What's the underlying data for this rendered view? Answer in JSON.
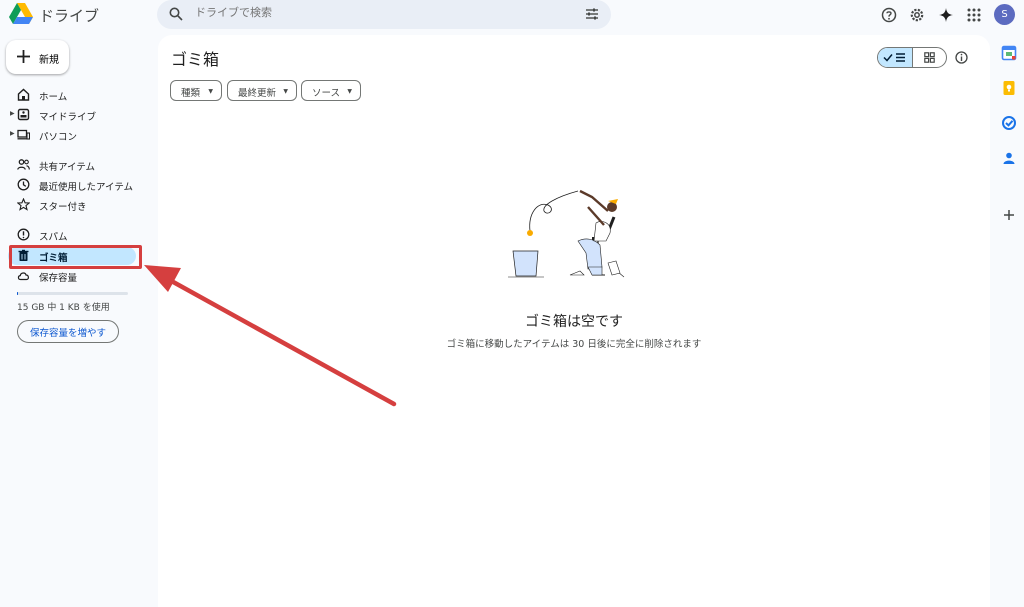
{
  "app": {
    "title": "ドライブ"
  },
  "search": {
    "placeholder": "ドライブで検索"
  },
  "avatar": {
    "initial": "S"
  },
  "sidebar": {
    "new_label": "新規",
    "items": [
      {
        "label": "ホーム"
      },
      {
        "label": "マイドライブ"
      },
      {
        "label": "パソコン"
      },
      {
        "label": "共有アイテム"
      },
      {
        "label": "最近使用したアイテム"
      },
      {
        "label": "スター付き"
      },
      {
        "label": "スパム"
      },
      {
        "label": "ゴミ箱"
      },
      {
        "label": "保存容量"
      }
    ],
    "storage_text": "15 GB 中 1 KB を使用",
    "storage_fraction": 0.01,
    "storage_button": "保存容量を増やす"
  },
  "main": {
    "title": "ゴミ箱",
    "filters": [
      {
        "label": "種類"
      },
      {
        "label": "最終更新"
      },
      {
        "label": "ソース"
      }
    ],
    "empty_title": "ゴミ箱は空です",
    "empty_subtitle": "ゴミ箱に移動したアイテムは 30 日後に完全に削除されます"
  },
  "colors": {
    "accent": "#0b57d0",
    "active_bg": "#c2e7ff",
    "annotation": "#d53f3f",
    "page_bg": "#f8fafd"
  },
  "icons": {
    "topbar": [
      "help-icon",
      "settings-icon",
      "gemini-icon",
      "apps-grid-icon"
    ],
    "side_panel": [
      "calendar-icon",
      "keep-icon",
      "tasks-icon",
      "contacts-icon",
      "add-icon"
    ]
  }
}
